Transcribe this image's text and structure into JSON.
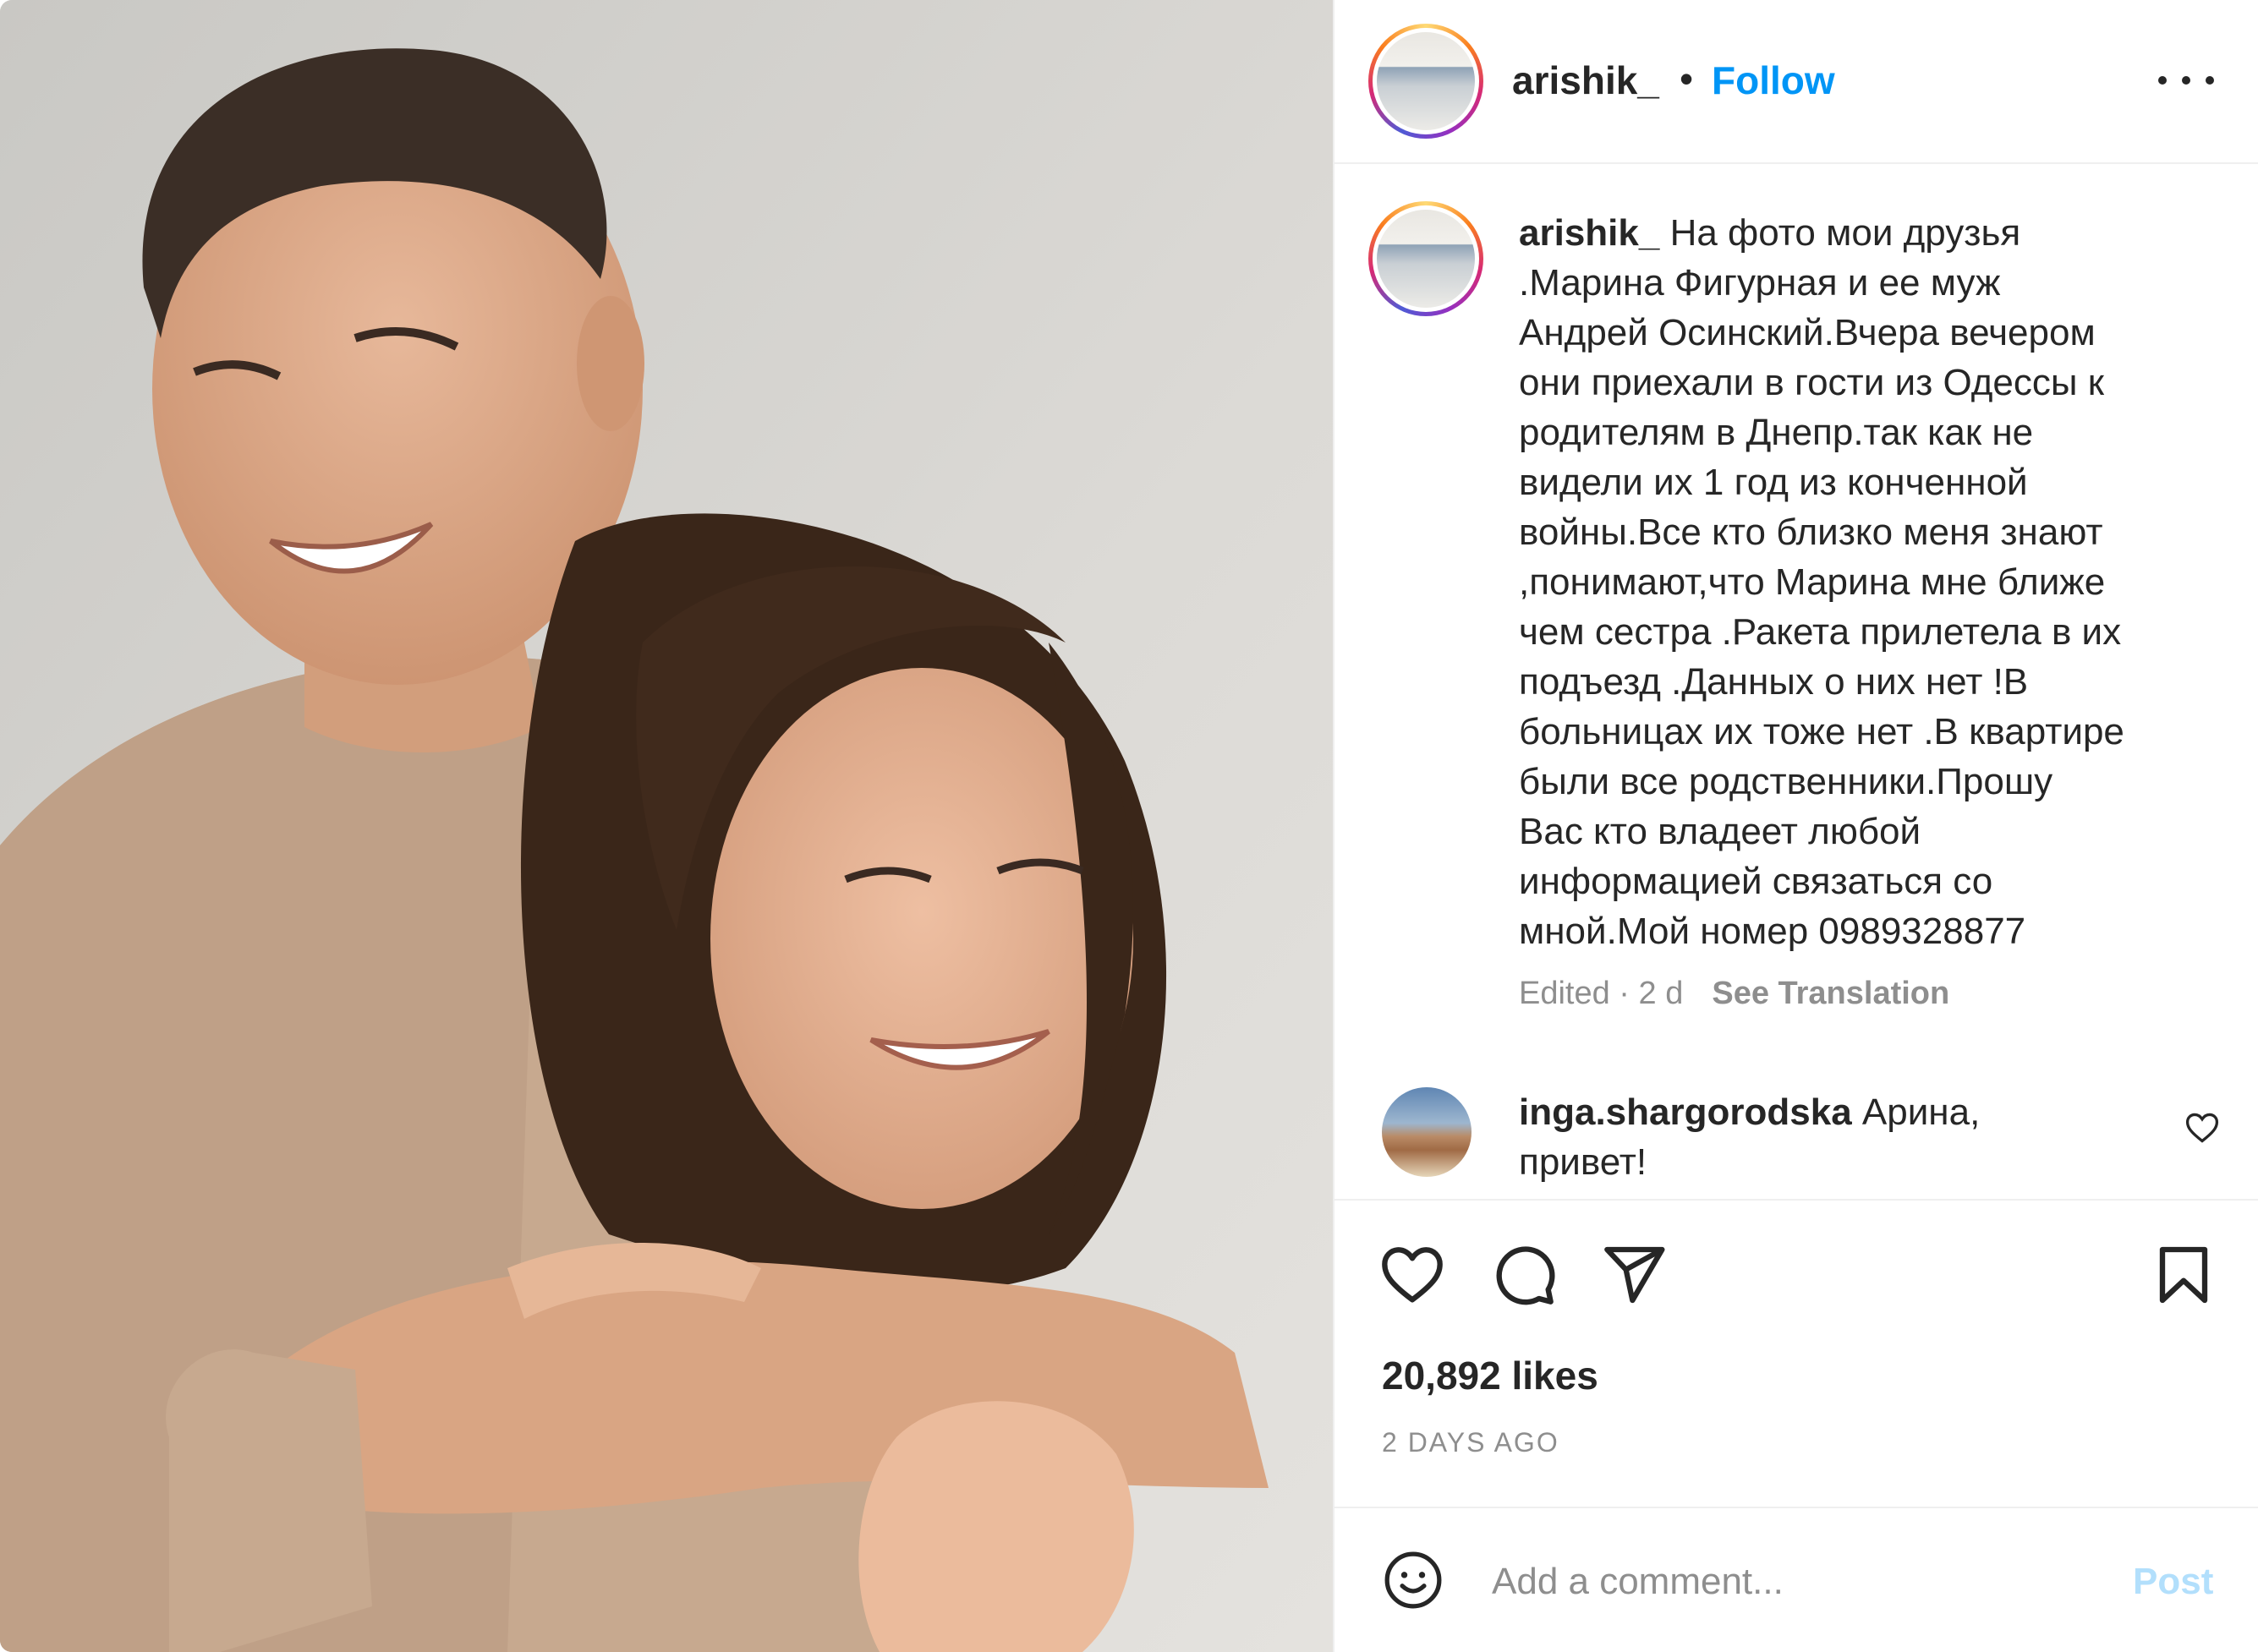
{
  "header": {
    "username": "arishik_",
    "separator": "•",
    "follow_label": "Follow",
    "more_icon": "more-horizontal-icon"
  },
  "post": {
    "caption_username": "arishik_",
    "caption_text": " На фото мои друзья\n.Марина Фигурная и ее муж\nАндрей Осинский.Вчера вечером\nони приехали в гости из Одессы к\nродителям в Днепр.так как не\nвидели их 1 год из конченной\nвойны.Все кто близко меня знают\n,понимают,что Марина мне ближе\nчем сестра .Ракета прилетела в их\nподъезд .Данных о них нет !В\nбольницах их тоже нет .В квартире\nбыли все родственники.Прошу\nВас кто владеет любой\nинформацией связаться со\nмной.Мой номер 0989328877",
    "edited_label": "Edited · 2 d",
    "see_translation_label": "See Translation"
  },
  "comment": {
    "username": "inga.shargorodska",
    "text": " Арина,\nпривет!"
  },
  "actions": {
    "like_icon": "heart-icon",
    "comment_icon": "comment-icon",
    "share_icon": "paper-plane-icon",
    "save_icon": "bookmark-icon"
  },
  "likes_label": "20,892 likes",
  "date_label": "2 DAYS AGO",
  "add_comment": {
    "placeholder": "Add a comment...",
    "post_label": "Post",
    "emoji_icon": "smiley-icon"
  },
  "colors": {
    "follow": "#0095f6",
    "post_disabled": "#b2dffc",
    "secondary_text": "#8e8e8e",
    "primary_text": "#262626"
  }
}
